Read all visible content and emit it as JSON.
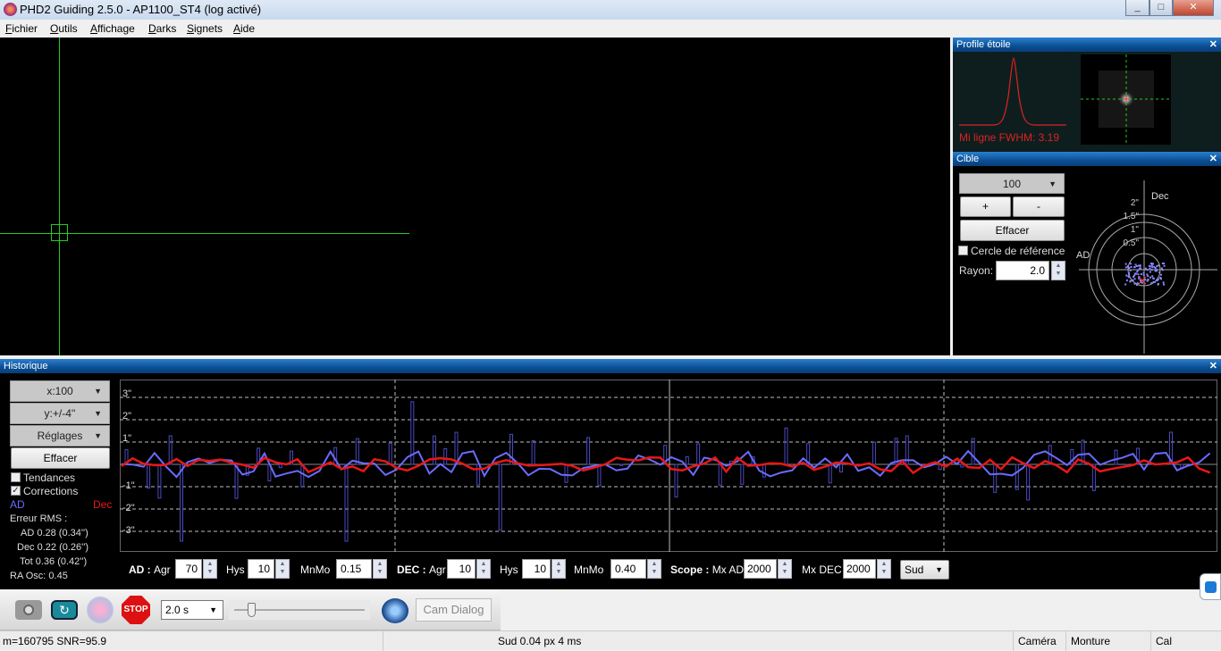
{
  "window": {
    "title": "PHD2 Guiding 2.5.0 - AP1100_ST4 (log activé)",
    "minimize": "_",
    "maximize": "□",
    "close": "✕"
  },
  "menu": [
    "Fichier",
    "Outils",
    "Affichage",
    "Darks",
    "Signets",
    "Aide"
  ],
  "profile": {
    "title": "Profile étoile",
    "fwhm": "Mi ligne FWHM: 3.19"
  },
  "target": {
    "title": "Cible",
    "scale": "100",
    "plus": "+",
    "minus": "-",
    "clear": "Effacer",
    "ref_circle": "Cercle de référence",
    "ref_checked": false,
    "radius_label": "Rayon:",
    "radius_value": "2.0",
    "axis_dec": "Dec",
    "axis_ad": "AD",
    "rings": [
      "2\"",
      "1.5\"",
      "1\"",
      "0.5\""
    ]
  },
  "history": {
    "title": "Historique",
    "x_scale": "x:100",
    "y_scale": "y:+/-4''",
    "settings": "Réglages",
    "clear": "Effacer",
    "trends": "Tendances",
    "trends_checked": false,
    "corrections": "Corrections",
    "corrections_checked": true,
    "legend_ad": "AD",
    "legend_dec": "Dec",
    "rms_title": "Erreur RMS :",
    "rms_ad": "AD 0.28 (0.34'')",
    "rms_dec": "Dec 0.22 (0.26'')",
    "rms_tot": "Tot 0.36 (0.42'')",
    "ra_osc": "RA Osc: 0.45",
    "y_ticks": [
      "3\"",
      "2\"",
      "1\"",
      "-1\"",
      "-2\"",
      "-3\""
    ],
    "colors": {
      "ad": "#6b6bff",
      "dec": "#e81818"
    }
  },
  "params": {
    "ad_label": "AD : ",
    "agr": "Agr",
    "hys": "Hys",
    "mnmo": "MnMo",
    "ad_agr": "70",
    "ad_hys": "10",
    "ad_mnmo": "0.15",
    "dec_label": "DEC : ",
    "dec_agr": "10",
    "dec_hys": "10",
    "dec_mnmo": "0.40",
    "scope_label": "Scope : ",
    "mx_ad_label": "Mx AD",
    "mx_ad": "2000",
    "mx_dec_label": "Mx DEC",
    "mx_dec": "2000",
    "dec_mode": "Sud"
  },
  "toolbar": {
    "exposure": "2.0 s",
    "cam_dialog": "Cam Dialog",
    "stop": "STOP"
  },
  "status": {
    "left": "m=160795 SNR=95.9",
    "center": "Sud 0.04 px 4 ms",
    "camera": "Caméra",
    "mount": "Monture",
    "cal": "Cal"
  }
}
